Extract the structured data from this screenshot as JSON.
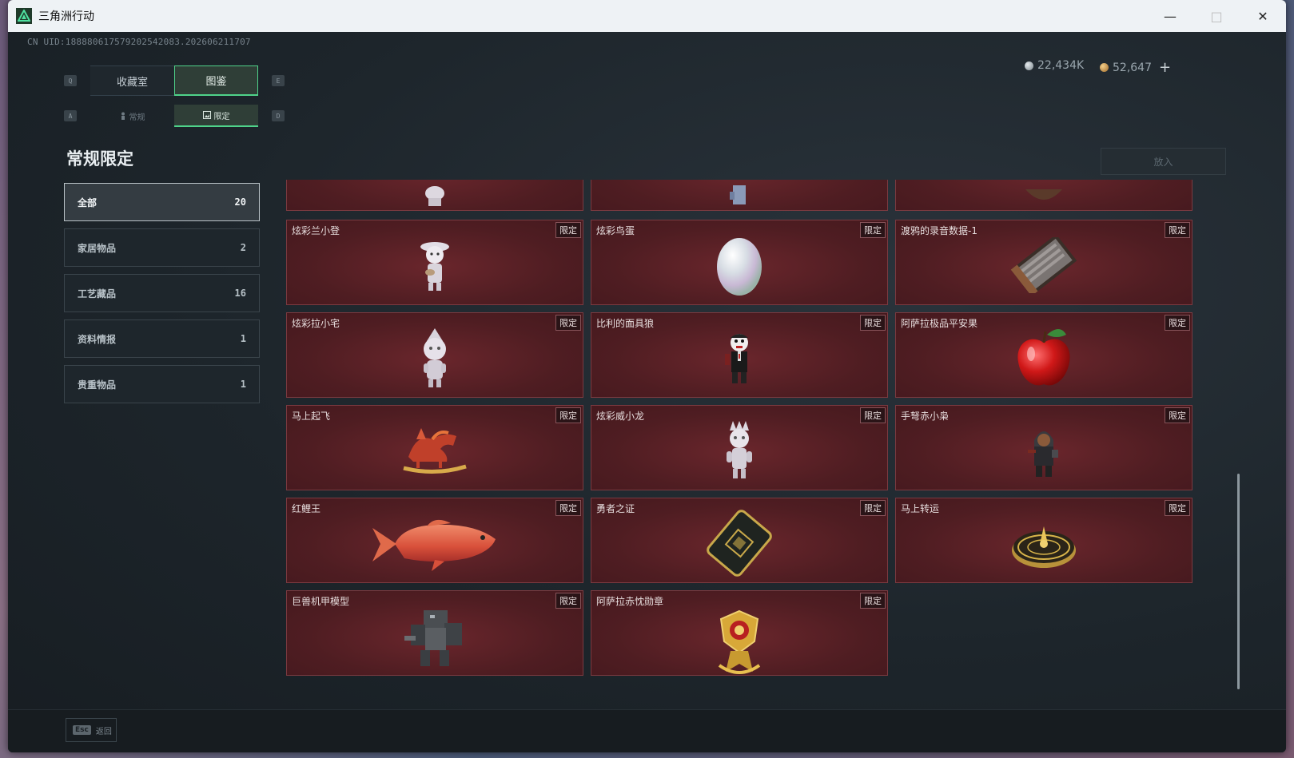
{
  "window": {
    "title": "三角洲行动",
    "minimize": "—",
    "maximize": "□",
    "close": "✕"
  },
  "uid": "CN UID:18888061757920254​2083.202606211707",
  "currency": {
    "silver_value": "22,434K",
    "gold_value": "52,647",
    "add": "+"
  },
  "tabs": {
    "left_key": "Q",
    "right_key": "E",
    "main": [
      {
        "label": "收藏室"
      },
      {
        "label": "图鉴"
      }
    ],
    "sub_left_key": "A",
    "sub_right_key": "D",
    "sub": [
      {
        "label": "常规"
      },
      {
        "label": "限定"
      }
    ]
  },
  "section_title": "常规限定",
  "categories": [
    {
      "label": "全部",
      "count": "20"
    },
    {
      "label": "家居物品",
      "count": "2"
    },
    {
      "label": "工艺藏品",
      "count": "16"
    },
    {
      "label": "资料情报",
      "count": "1"
    },
    {
      "label": "贵重物品",
      "count": "1"
    }
  ],
  "put_button": "放入",
  "tag_label": "限定",
  "items": [
    {
      "name": "炫彩兰小登",
      "icon": "figurine-icon"
    },
    {
      "name": "炫彩鸟蛋",
      "icon": "egg-icon"
    },
    {
      "name": "渡鸦的录音数据-1",
      "icon": "cassette-icon"
    },
    {
      "name": "炫彩拉小宅",
      "icon": "figurine-icon"
    },
    {
      "name": "比利的面具狼",
      "icon": "puppet-icon"
    },
    {
      "name": "阿萨拉极品平安果",
      "icon": "apple-icon"
    },
    {
      "name": "马上起飞",
      "icon": "horse-icon"
    },
    {
      "name": "炫彩威小龙",
      "icon": "figurine-icon"
    },
    {
      "name": "手弩赤小枭",
      "icon": "hooded-figure-icon"
    },
    {
      "name": "红鲤王",
      "icon": "fish-icon"
    },
    {
      "name": "勇者之证",
      "icon": "card-icon"
    },
    {
      "name": "马上转运",
      "icon": "compass-icon"
    },
    {
      "name": "巨兽机甲模型",
      "icon": "mech-icon"
    },
    {
      "name": "阿萨拉赤忱勋章",
      "icon": "medal-icon"
    }
  ],
  "footer": {
    "esc_key": "Esc",
    "back_label": "返回"
  }
}
